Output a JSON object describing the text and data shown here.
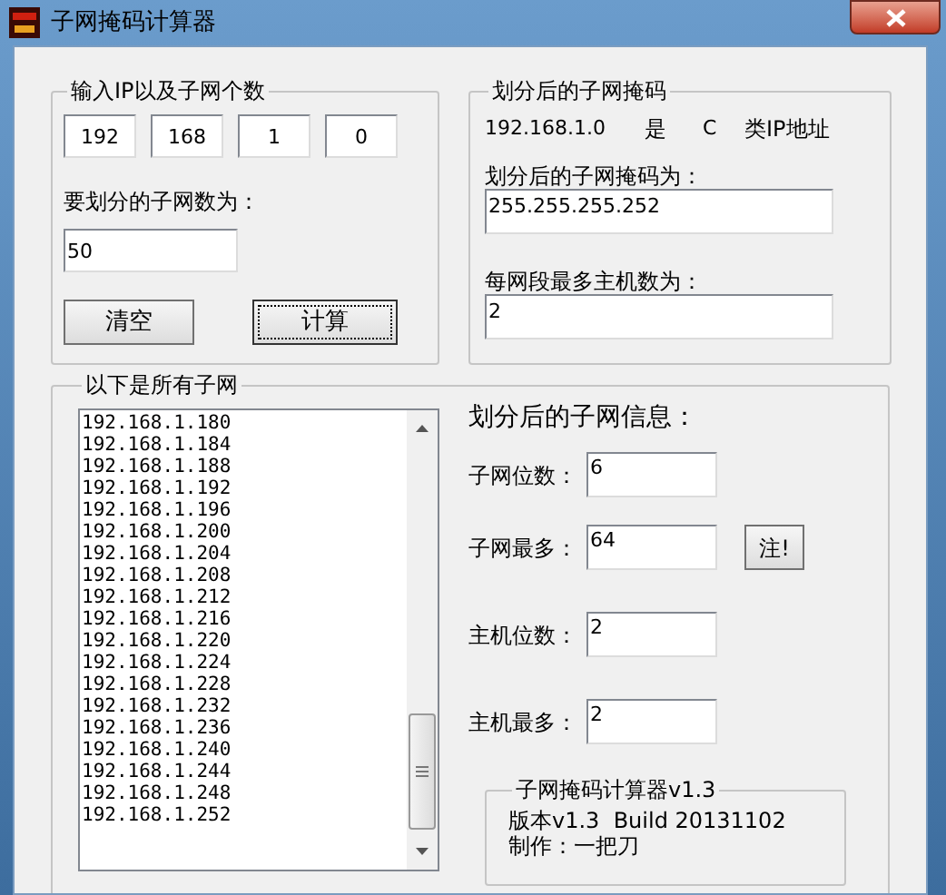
{
  "window": {
    "title": "子网掩码计算器"
  },
  "input_group": {
    "title": "输入IP以及子网个数",
    "ip_octets": [
      "192",
      "168",
      "1",
      "0"
    ],
    "subnet_count_label": "要划分的子网数为：",
    "subnet_count": "50",
    "buttons": [
      {
        "label": "清空",
        "focused": false
      },
      {
        "label": "计算",
        "focused": true
      }
    ]
  },
  "mask_group": {
    "title": "划分后的子网掩码",
    "ip": "192.168.1.0",
    "is_label": "是",
    "ip_class": "C",
    "class_suffix": "类IP地址",
    "mask_label": "划分后的子网掩码为：",
    "mask": "255.255.255.252",
    "hosts_label": "每网段最多主机数为：",
    "hosts": "2"
  },
  "subnets_group": {
    "title": "以下是所有子网",
    "subnets": [
      "192.168.1.180",
      "192.168.1.184",
      "192.168.1.188",
      "192.168.1.192",
      "192.168.1.196",
      "192.168.1.200",
      "192.168.1.204",
      "192.168.1.208",
      "192.168.1.212",
      "192.168.1.216",
      "192.168.1.220",
      "192.168.1.224",
      "192.168.1.228",
      "192.168.1.232",
      "192.168.1.236",
      "192.168.1.240",
      "192.168.1.244",
      "192.168.1.248",
      "192.168.1.252"
    ]
  },
  "info": {
    "title": "划分后的子网信息：",
    "fields": [
      {
        "label": "子网位数：",
        "value": "6"
      },
      {
        "label": "子网最多：",
        "value": "64",
        "note_button": "注!"
      },
      {
        "label": "主机位数：",
        "value": "2"
      },
      {
        "label": "主机最多：",
        "value": "2"
      }
    ]
  },
  "about": {
    "title": "子网掩码计算器v1.3",
    "lines": [
      "版本v1.3  Build 20131102",
      "制作：一把刀"
    ]
  }
}
